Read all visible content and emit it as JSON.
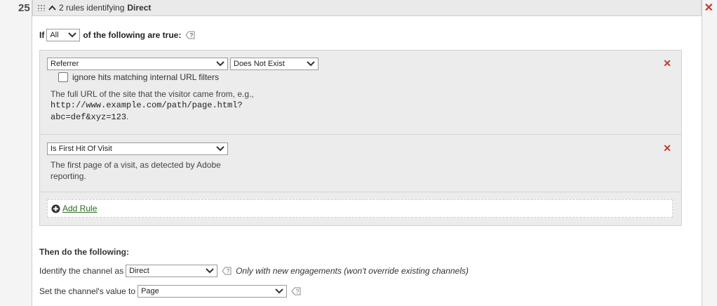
{
  "rule_number": "25",
  "header": {
    "count_text": "2 rules identifying",
    "channel_bold": "Direct"
  },
  "condition": {
    "prefix": "If",
    "match_select": "All",
    "suffix": "of the following are true:"
  },
  "rules": [
    {
      "field": "Referrer",
      "operator": "Does Not Exist",
      "checkbox_label": "ignore hits matching internal URL filters",
      "checkbox_checked": false,
      "description_line1": "The full URL of the site that the visitor came from, e.g.,",
      "description_code_line1": "http://www.example.com/path/page.html?",
      "description_code_line2": "abc=def&xyz=123",
      "description_end": "."
    },
    {
      "field": "Is First Hit Of Visit",
      "description_line1": "The first page of a visit, as detected by Adobe",
      "description_line2": "reporting."
    }
  ],
  "add_rule_label": "Add Rule",
  "then": {
    "title": "Then do the following:",
    "identify_label": "Identify the channel as",
    "identify_value": "Direct",
    "identify_note": "Only with new engagements (won't override existing channels)",
    "value_label": "Set the channel's value to",
    "value_value": "Page"
  },
  "icons": {
    "close": "close-icon",
    "help": "help-icon",
    "add": "plus-circle-icon",
    "dropdown": "chevron-down-icon",
    "collapse": "chevron-up-icon",
    "drag": "drag-handle-icon"
  },
  "colors": {
    "close_red": "#c0392b",
    "link_green": "#2a6b1d"
  }
}
